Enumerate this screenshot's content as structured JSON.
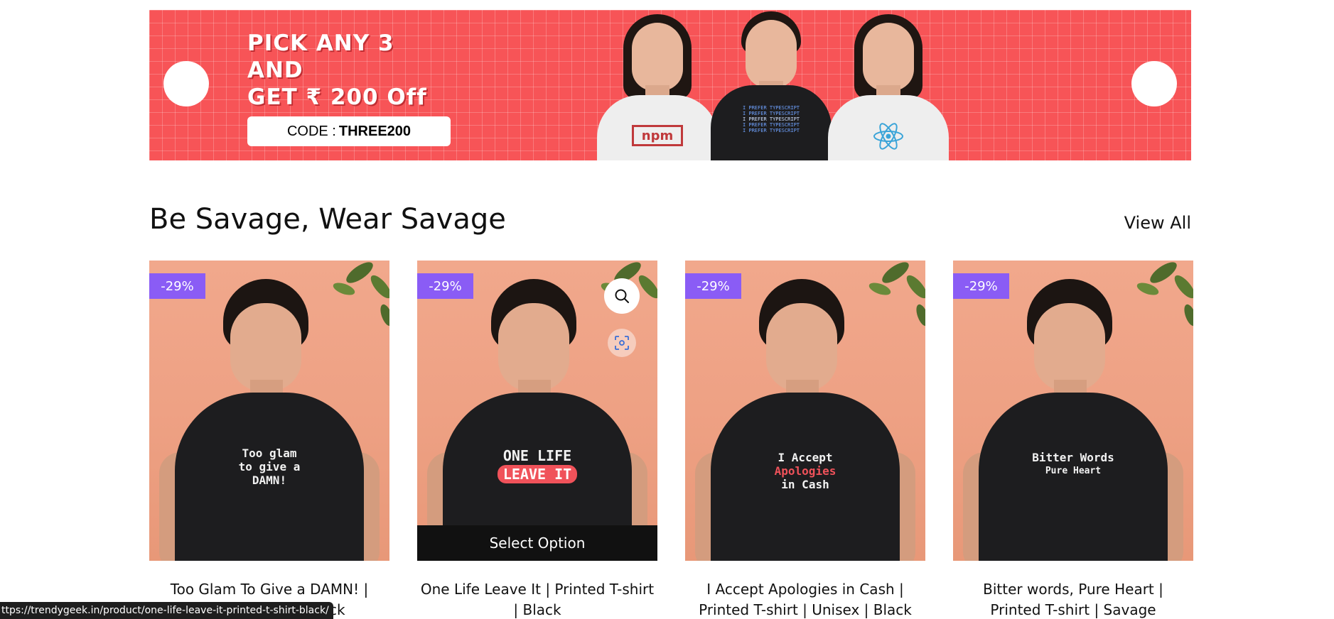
{
  "banner": {
    "promo_line1": "PICK ANY 3",
    "promo_line2": "AND",
    "promo_line3": "GET ₹ 200 Off",
    "code_label": "CODE :",
    "code_value": "THREE200",
    "background_color": "#f75457",
    "models": [
      {
        "shirt_color": "#f0f0f0",
        "print": "npm"
      },
      {
        "shirt_color": "#1d1d1f",
        "print": "I PREFER TYPESCRIPT"
      },
      {
        "shirt_color": "#f0f0f0",
        "print": "react-icon"
      }
    ]
  },
  "section": {
    "title": "Be Savage, Wear Savage",
    "view_all": "View All"
  },
  "products": [
    {
      "discount": "-29%",
      "print_lines": [
        "Too glam",
        "to give a",
        "DAMN!"
      ],
      "title": "Too Glam To Give a DAMN! | Printed T-shirt | Black"
    },
    {
      "discount": "-29%",
      "print_lines": [
        "ONE  LIFE",
        "LEAVE IT"
      ],
      "title": "One Life Leave It | Printed T-shirt | Black",
      "hover_action": "Select Option"
    },
    {
      "discount": "-29%",
      "print_lines": [
        "I Accept",
        "Apologies",
        "in Cash"
      ],
      "title": "I Accept Apologies in Cash | Printed T-shirt | Unisex | Black"
    },
    {
      "discount": "-29%",
      "print_lines": [
        "Bitter Words",
        "Pure Heart"
      ],
      "title": "Bitter words, Pure Heart | Printed T-shirt | Savage"
    }
  ],
  "status_bar": {
    "url": "ttps://trendygeek.in/product/one-life-leave-it-printed-t-shirt-black/"
  },
  "colors": {
    "discount_badge": "#8a5cf5",
    "select_option_bg": "#111111"
  }
}
